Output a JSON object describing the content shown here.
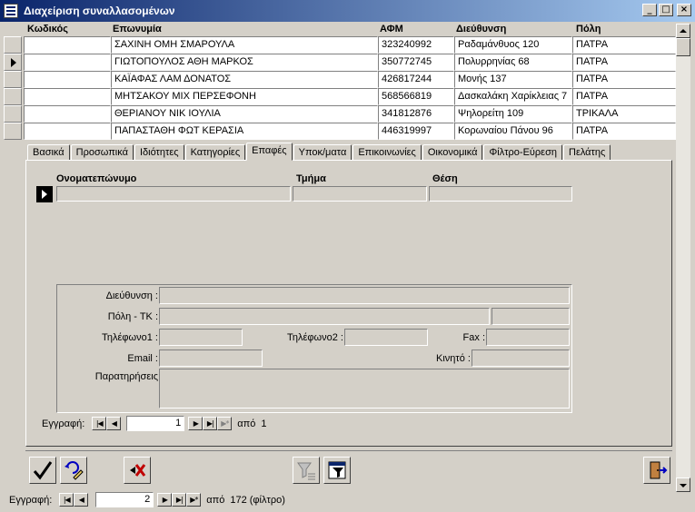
{
  "window": {
    "title": "Διαχείριση συναλλασομένων"
  },
  "grid": {
    "columns": [
      "Κωδικός",
      "Επωνυμία",
      "ΑΦΜ",
      "Διεύθυνση",
      "Πόλη"
    ],
    "rows": [
      {
        "code": "",
        "name": "ΣΑΧΙΝΗ ΟΜΗ ΣΜΑΡΟΥΛΑ",
        "afm": "323240992",
        "address": "Ραδαμάνθυος  120",
        "city": "ΠΑΤΡΑ"
      },
      {
        "code": "",
        "name": "ΓΙΩΤΟΠΟΥΛΟΣ ΑΘΗ ΜΑΡΚΟΣ",
        "afm": "350772745",
        "address": "Πολυρρηνίας  68",
        "city": "ΠΑΤΡΑ"
      },
      {
        "code": "",
        "name": "ΚΑΪΑΦΑΣ ΛΑΜ ΔΟΝΑΤΟΣ",
        "afm": "426817244",
        "address": "Μονής  137",
        "city": "ΠΑΤΡΑ"
      },
      {
        "code": "",
        "name": "ΜΗΤΣΑΚΟΥ  ΜΙΧ ΠΕΡΣΕΦΟΝΗ",
        "afm": "568566819",
        "address": "Δασκαλάκη Χαρίκλειας  7",
        "city": "ΠΑΤΡΑ"
      },
      {
        "code": "",
        "name": "ΘΕΡΙΑΝΟΥ ΝΙΚ ΙΟΥΛΙΑ",
        "afm": "341812876",
        "address": "Ψηλορείτη  109",
        "city": "ΤΡΙΚΑΛΑ"
      },
      {
        "code": "",
        "name": "ΠΑΠΑΣΤΑΘΗ ΦΩΤ ΚΕΡΑΣΙΑ",
        "afm": "446319997",
        "address": "Κορωναίου Πάνου  96",
        "city": "ΠΑΤΡΑ"
      }
    ]
  },
  "tabs": [
    "Βασικά",
    "Προσωπικά",
    "Ιδιότητες",
    "Κατηγορίες",
    "Επαφές",
    "Υποκ/ματα",
    "Επικοινωνίες",
    "Οικονομικά",
    "Φίλτρο-Εύρεση",
    "Πελάτης"
  ],
  "subform": {
    "columns": [
      "Ονοματεπώνυμο",
      "Τμήμα",
      "Θέση"
    ]
  },
  "details": {
    "address_label": "Διεύθυνση :",
    "city_zip_label": "Πόλη - ΤΚ :",
    "phone1_label": "Τηλέφωνο1 :",
    "phone2_label": "Τηλέφωνο2 :",
    "fax_label": "Fax :",
    "email_label": "Email :",
    "mobile_label": "Κινητό :",
    "notes_label": "Παρατηρήσεις"
  },
  "subnav": {
    "label": "Εγγραφή:",
    "current": "1",
    "of_label": "από",
    "total": "1"
  },
  "mainnav": {
    "label": "Εγγραφή:",
    "current": "2",
    "of_label": "από",
    "total": "172 (φίλτρο)"
  },
  "icons": {
    "save": "checkmark-icon",
    "undo": "undo-pencil-icon",
    "delete": "delete-record-icon",
    "filter": "filter-icon",
    "filter_form": "filter-by-form-icon",
    "exit": "exit-door-icon"
  }
}
